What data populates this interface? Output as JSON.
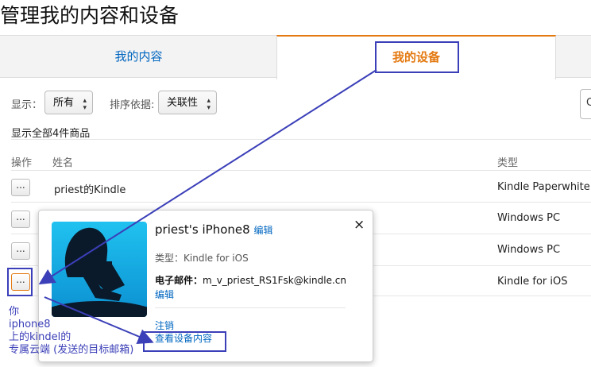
{
  "page": {
    "title": "管理我的内容和设备"
  },
  "tabs": [
    {
      "label": "我的内容"
    },
    {
      "label": "我的设备"
    }
  ],
  "filters": {
    "show_label": "显示：",
    "show_value": "所有",
    "sort_label": "排序依据:",
    "sort_value": "关联性",
    "summary": "显示全部4件商品"
  },
  "table": {
    "headers": {
      "action": "操作",
      "name": "姓名",
      "type": "类型"
    },
    "rows": [
      {
        "action": "...",
        "name": "priest的Kindle",
        "type": "Kindle Paperwhite"
      },
      {
        "action": "...",
        "name": "",
        "type": "Windows PC"
      },
      {
        "action": "...",
        "name": "",
        "type": "Windows PC"
      },
      {
        "action": "...",
        "name": "",
        "type": "Kindle for iOS"
      }
    ]
  },
  "popup": {
    "device_name": "priest's iPhone8",
    "edit_link": "编辑",
    "type_label": "类型：",
    "type_value": "Kindle for iOS",
    "email_label": "电子邮件：",
    "email_value": "m_v_priest_RS1Fsk@kindle.cn",
    "email_edit": "编辑",
    "deregister": "注销",
    "view_content": "查看设备内容",
    "close": "×"
  },
  "annotation": {
    "lines": [
      "你",
      "iphone8",
      "上的kindel的",
      "专属云端 (发送的目标邮箱)"
    ]
  },
  "colors": {
    "link": "#0066c0",
    "accent": "#e47911",
    "annotation": "#3b3fb8"
  }
}
